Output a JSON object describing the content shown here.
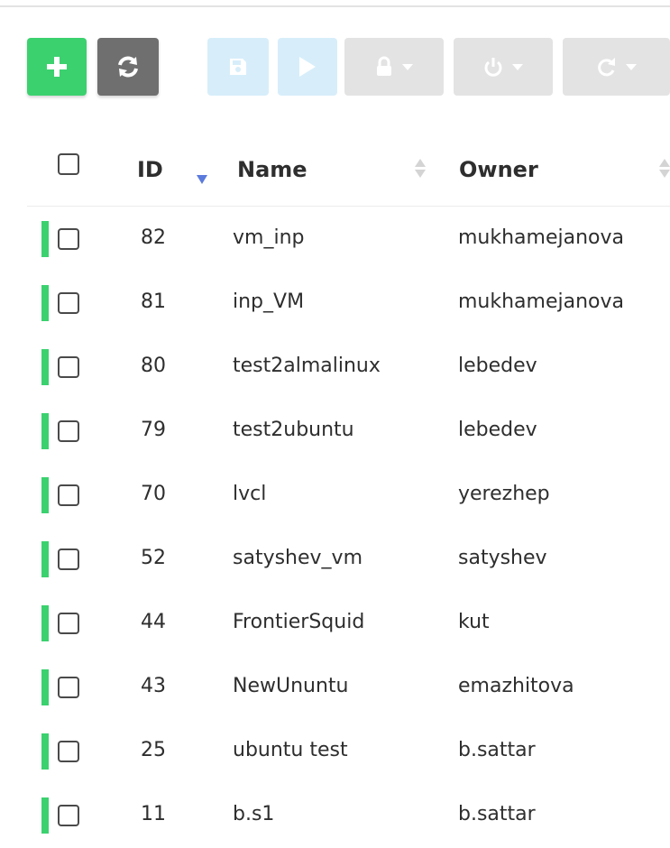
{
  "toolbar": {
    "buttons": [
      {
        "name": "add",
        "icon": "plus-icon",
        "color": "#3bd16f"
      },
      {
        "name": "refresh",
        "icon": "refresh-icon",
        "color": "#6f6f6f"
      },
      {
        "name": "save",
        "icon": "floppy-disk-icon",
        "color": "#d7eefa"
      },
      {
        "name": "play",
        "icon": "play-icon",
        "color": "#d7eefa"
      },
      {
        "name": "lock",
        "icon": "lock-icon",
        "color": "#e3e3e3"
      },
      {
        "name": "power",
        "icon": "power-icon",
        "color": "#e3e3e3"
      },
      {
        "name": "reboot",
        "icon": "redo-icon",
        "color": "#e3e3e3"
      }
    ]
  },
  "table": {
    "columns": {
      "id": "ID",
      "name": "Name",
      "owner": "Owner"
    },
    "sort": {
      "column": "ID",
      "direction": "descending"
    },
    "status_color": "#3bd16f",
    "rows": [
      {
        "id": "82",
        "name": "vm_inp",
        "owner": "mukhamejanova"
      },
      {
        "id": "81",
        "name": "inp_VM",
        "owner": "mukhamejanova"
      },
      {
        "id": "80",
        "name": "test2almalinux",
        "owner": "lebedev"
      },
      {
        "id": "79",
        "name": "test2ubuntu",
        "owner": "lebedev"
      },
      {
        "id": "70",
        "name": "lvcl",
        "owner": "yerezhep"
      },
      {
        "id": "52",
        "name": "satyshev_vm",
        "owner": "satyshev"
      },
      {
        "id": "44",
        "name": "FrontierSquid",
        "owner": "kut"
      },
      {
        "id": "43",
        "name": "NewUnuntu",
        "owner": "emazhitova"
      },
      {
        "id": "25",
        "name": "ubuntu test",
        "owner": "b.sattar"
      },
      {
        "id": "11",
        "name": "b.s1",
        "owner": "b.sattar"
      }
    ]
  }
}
